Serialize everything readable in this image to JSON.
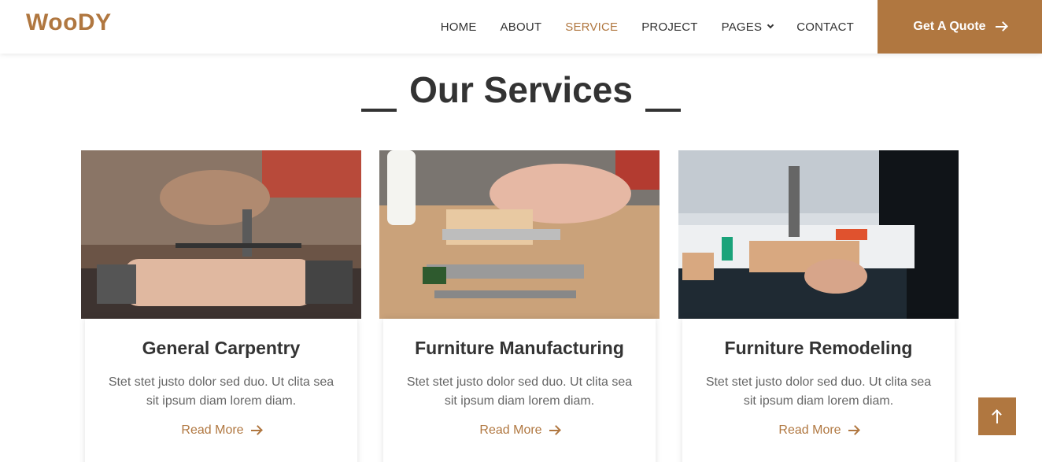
{
  "brand": {
    "name": "WooDY"
  },
  "nav": {
    "items": [
      "HOME",
      "ABOUT",
      "SERVICE",
      "PROJECT",
      "PAGES",
      "CONTACT"
    ],
    "active": "SERVICE",
    "cta_label": "Get A Quote"
  },
  "section": {
    "title": "Our Services"
  },
  "services": [
    {
      "title": "General Carpentry",
      "text": "Stet stet justo dolor sed duo. Ut clita sea sit ipsum diam lorem diam.",
      "link": "Read More"
    },
    {
      "title": "Furniture Manufacturing",
      "text": "Stet stet justo dolor sed duo. Ut clita sea sit ipsum diam lorem diam.",
      "link": "Read More"
    },
    {
      "title": "Furniture Remodeling",
      "text": "Stet stet justo dolor sed duo. Ut clita sea sit ipsum diam lorem diam.",
      "link": "Read More"
    }
  ],
  "icons": {
    "cta": "arrow-right-icon",
    "back_to_top": "arrow-up-icon",
    "dropdown": "chevron-down-icon"
  },
  "colors": {
    "accent": "#b07740",
    "text": "#333333",
    "muted": "#666666"
  }
}
